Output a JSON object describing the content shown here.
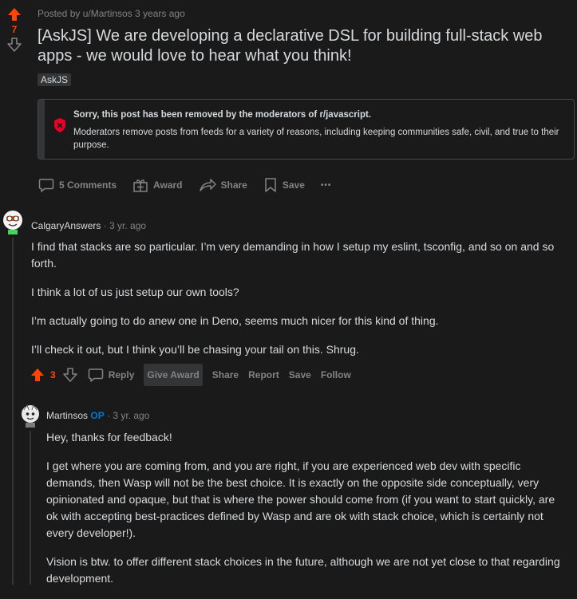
{
  "post": {
    "score": "7",
    "meta": "Posted by u/Martinsos 3 years ago",
    "title": "[AskJS] We are developing a declarative DSL for building full-stack web apps - we would love to hear what you think!",
    "flair": "AskJS",
    "removed_title": "Sorry, this post has been removed by the moderators of r/javascript.",
    "removed_body": "Moderators remove posts from feeds for a variety of reasons, including keeping communities safe, civil, and true to their purpose.",
    "actions": {
      "comments": "5 Comments",
      "award": "Award",
      "share": "Share",
      "save": "Save",
      "more": "•••"
    }
  },
  "comments": [
    {
      "user": "CalgaryAnswers",
      "time": "· 3 yr. ago",
      "paragraphs": [
        "I find that stacks are so particular. I’m very demanding in how I setup my eslint, tsconfig, and so on and so forth.",
        "I think a lot of us just setup our own tools?",
        "I’m actually going to do anew one in Deno, seems much nicer for this kind of thing.",
        "I’ll check it out, but I think you’ll be chasing your tail on this. Shrug."
      ],
      "score": "3",
      "actions": {
        "reply": "Reply",
        "give_award": "Give Award",
        "share": "Share",
        "report": "Report",
        "save": "Save",
        "follow": "Follow"
      }
    },
    {
      "user": "Martinsos",
      "op": "OP",
      "time": "· 3 yr. ago",
      "paragraphs": [
        "Hey, thanks for feedback!",
        "I get where you are coming from, and you are right, if you are experienced web dev with specific demands, then Wasp will not be the best choice. It is exactly on the opposite side conceptually, very opinionated and opaque, but that is where the power should come from (if you want to start quickly, are ok with accepting best-practices defined by Wasp and are ok with stack choice, which is certainly not every developer!).",
        "Vision is btw. to offer different stack choices in the future, although we are not yet close to that regarding development."
      ]
    }
  ],
  "colors": {
    "upvote": "#ff4500",
    "background": "#1a1a1b",
    "muted": "#818384",
    "op": "#0079d3",
    "removed_icon": "#ea0027"
  },
  "icons": [
    "upvote-arrow-icon",
    "downvote-arrow-icon",
    "shield-x-icon",
    "comment-bubble-icon",
    "gift-icon",
    "share-arrow-icon",
    "bookmark-icon",
    "more-dots-icon"
  ]
}
